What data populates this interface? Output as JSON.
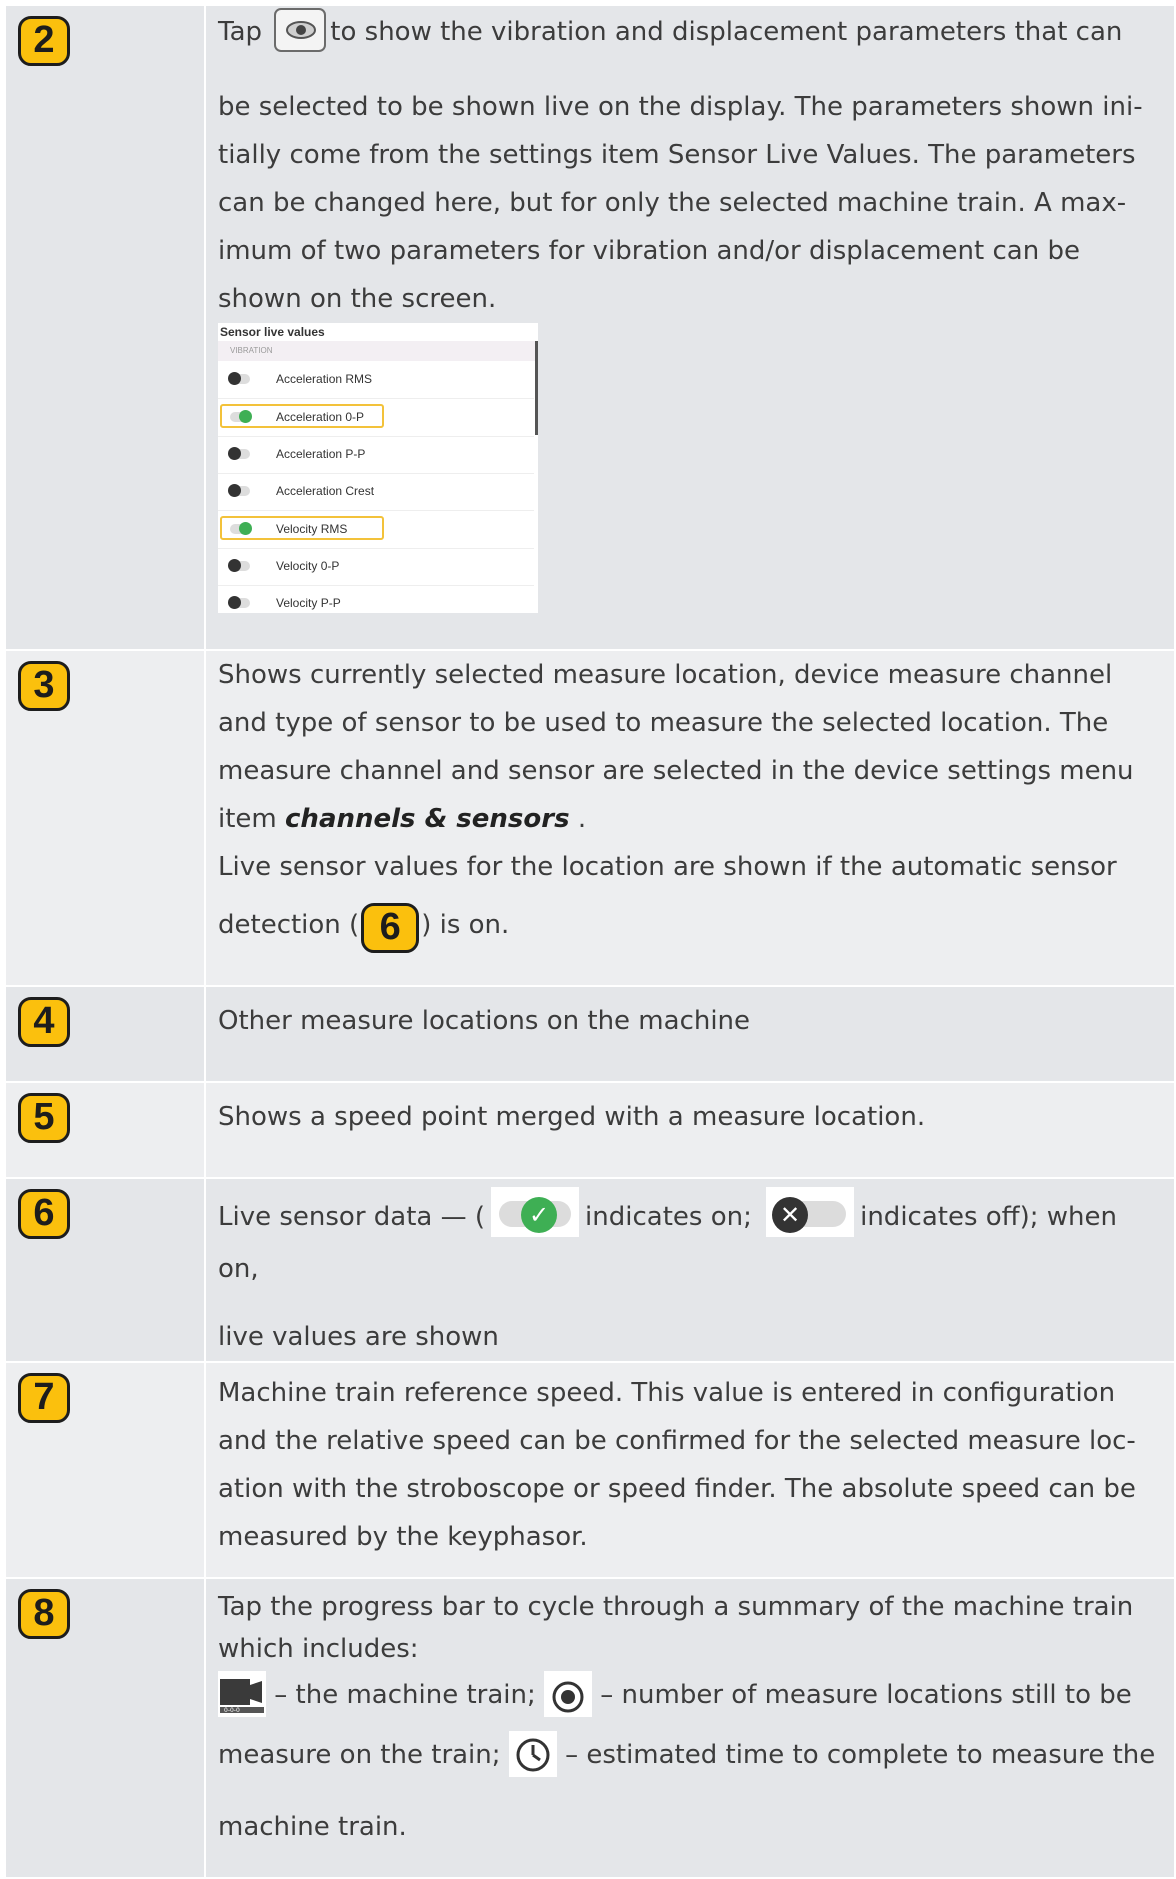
{
  "rows": {
    "r2": {
      "badge": "2",
      "text_before_icon": "Tap",
      "icon": "eye-icon",
      "text_lines": [
        "to show the vibration and displacement parameters that can",
        "be selected to be shown live on the display. The parameters shown ini-",
        "tially come from the settings item Sensor Live Values. The parameters",
        "can be changed here, but for only the selected machine train. A max-",
        "imum of two parameters for vibration and/or displacement can be",
        "shown on the screen."
      ],
      "panel": {
        "title": "Sensor live values",
        "section": "VIBRATION",
        "items": [
          {
            "label": "Acceleration RMS",
            "state": "off"
          },
          {
            "label": "Acceleration 0-P",
            "state": "on"
          },
          {
            "label": "Acceleration P-P",
            "state": "off"
          },
          {
            "label": "Acceleration Crest",
            "state": "off"
          },
          {
            "label": "Velocity RMS",
            "state": "on"
          },
          {
            "label": "Velocity 0-P",
            "state": "off"
          },
          {
            "label": "Velocity P-P",
            "state": "off"
          }
        ]
      }
    },
    "r3": {
      "badge": "3",
      "lines": [
        "Shows currently selected measure location, device measure channel",
        "and type of sensor to be used to measure the selected location. The",
        "measure channel and sensor are selected in the device settings menu"
      ],
      "item_prefix": "item",
      "item_bold": "channels & sensors",
      "item_suffix": ".",
      "line5": "Live sensor values for the location are shown if the automatic sensor",
      "line6_before": "detection (",
      "inline_badge": "6",
      "line6_after": ") is on."
    },
    "r4": {
      "badge": "4",
      "text": "Other measure locations on the machine"
    },
    "r5": {
      "badge": "5",
      "text": "Shows a speed point merged with a measure location."
    },
    "r6": {
      "badge": "6",
      "part1": "Live sensor data — (",
      "part2": "indicates on;",
      "part3": "indicates off); when on,",
      "line2": "live values are shown"
    },
    "r7": {
      "badge": "7",
      "lines": [
        "Machine train reference speed. This value is entered in configuration",
        "and the relative speed can be confirmed for the selected measure loc-",
        "ation with the stroboscope or speed finder. The absolute speed can be",
        "measured by the keyphasor."
      ]
    },
    "r8": {
      "badge": "8",
      "line1": "Tap the progress bar to cycle through a summary of the machine train",
      "line2": "which includes:",
      "a": "– the machine train;",
      "b": "– number of measure locations still to be",
      "c1": "measure on the train;",
      "c2": "– estimated time to complete to measure the",
      "d": "machine train.",
      "icons": [
        "machine-train-icon",
        "measure-location-icon",
        "clock-icon"
      ]
    }
  }
}
